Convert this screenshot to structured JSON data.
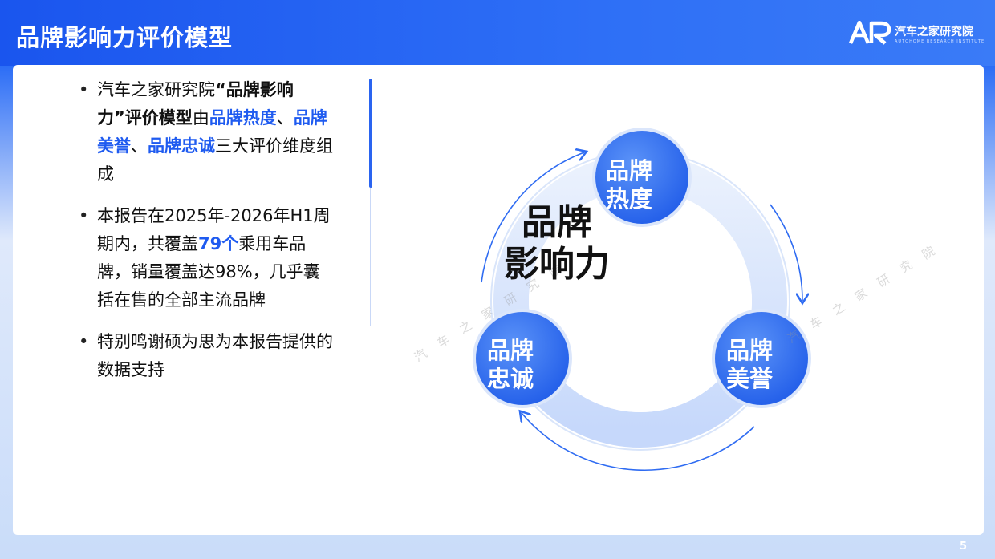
{
  "header": {
    "title": "品牌影响力评价模型",
    "brand_mark": "AR",
    "brand_name": "汽车之家研究院",
    "brand_subtitle": "AUTOHOME RESEARCH INSTITUTE"
  },
  "bullets": [
    {
      "parts": [
        {
          "text": "汽车之家研究院",
          "style": "normal"
        },
        {
          "text": "“品牌影响力”评价模型",
          "style": "bold"
        },
        {
          "text": "由",
          "style": "normal"
        },
        {
          "text": "品牌热度",
          "style": "blue"
        },
        {
          "text": "、",
          "style": "normal"
        },
        {
          "text": "品牌美誉",
          "style": "blue"
        },
        {
          "text": "、",
          "style": "normal"
        },
        {
          "text": "品牌忠诚",
          "style": "blue"
        },
        {
          "text": "三大评价维度组成",
          "style": "normal"
        }
      ]
    },
    {
      "parts": [
        {
          "text": "本报告在2025年-2026年H1周期内，共覆盖",
          "style": "normal"
        },
        {
          "text": "79个",
          "style": "blue"
        },
        {
          "text": "乘用车品牌，销量覆盖达98%，几乎囊括在售的全部主流品牌",
          "style": "normal"
        }
      ]
    },
    {
      "parts": [
        {
          "text": "特别鸣谢硕为思为本报告提供的数据支持",
          "style": "normal"
        }
      ]
    }
  ],
  "diagram": {
    "hub": {
      "line1": "品牌",
      "line2": "影响力"
    },
    "nodes": {
      "top": {
        "line1": "品牌",
        "line2": "热度"
      },
      "left": {
        "line1": "品牌",
        "line2": "忠诚"
      },
      "right": {
        "line1": "品牌",
        "line2": "美誉"
      }
    }
  },
  "watermark": "汽车之家研究院",
  "page_number": "5",
  "colors": {
    "primary_blue": "#1f5bf0",
    "node_blue": "#2f6cf2",
    "ring_light": "#dbe6fb"
  }
}
